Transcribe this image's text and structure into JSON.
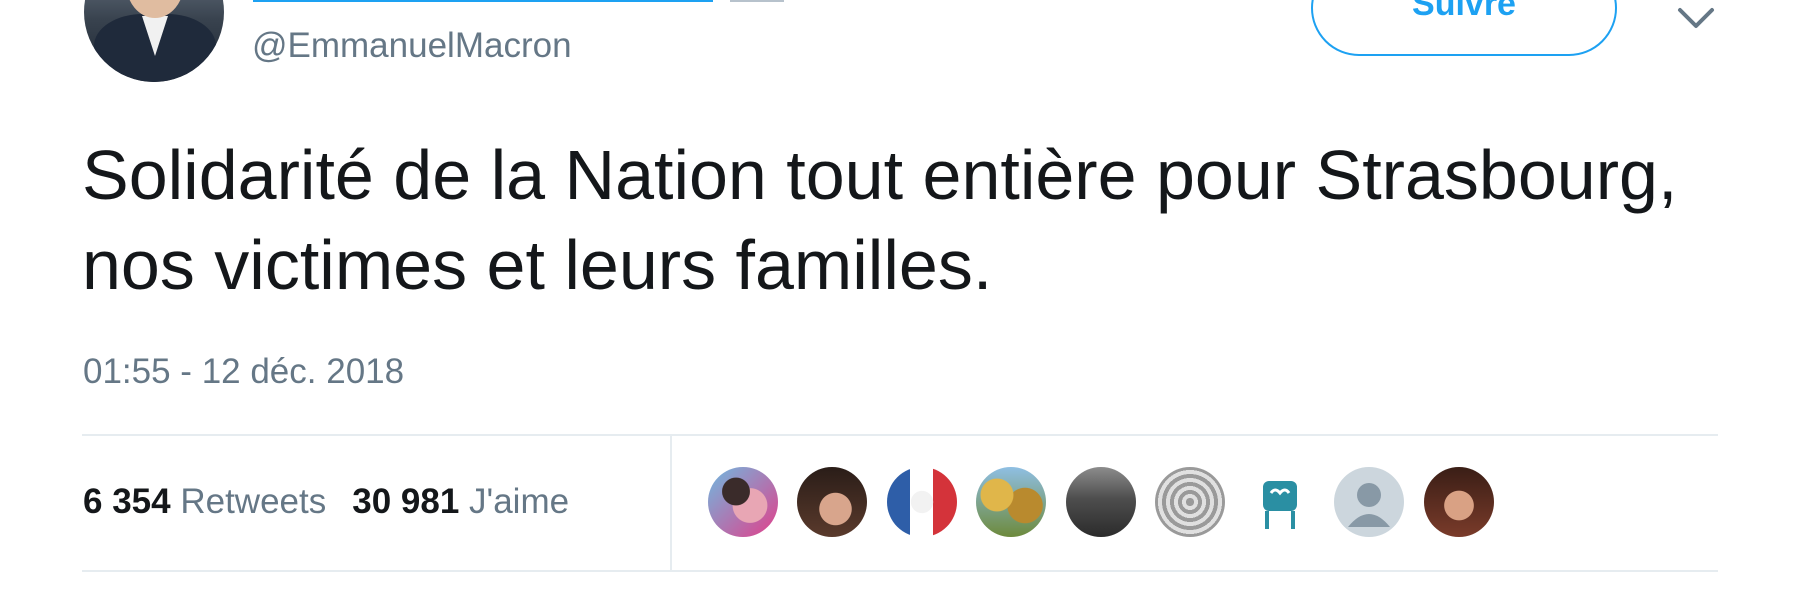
{
  "header": {
    "handle": "@EmmanuelMacron",
    "follow_label": "Suivre"
  },
  "tweet": {
    "text": "Solidarité de la Nation tout entière pour Strasbourg, nos victimes et leurs familles.",
    "timestamp": "01:55 - 12 déc. 2018"
  },
  "stats": {
    "retweets_count": "6 354",
    "retweets_label": "Retweets",
    "likes_count": "30 981",
    "likes_label": "J'aime"
  },
  "colors": {
    "accent": "#1da1f2",
    "text": "#14171a",
    "secondary": "#657786",
    "divider": "#e6ecf0"
  },
  "icons": {
    "more": "chevron-down-icon",
    "default_avatar": "default-user-icon"
  }
}
